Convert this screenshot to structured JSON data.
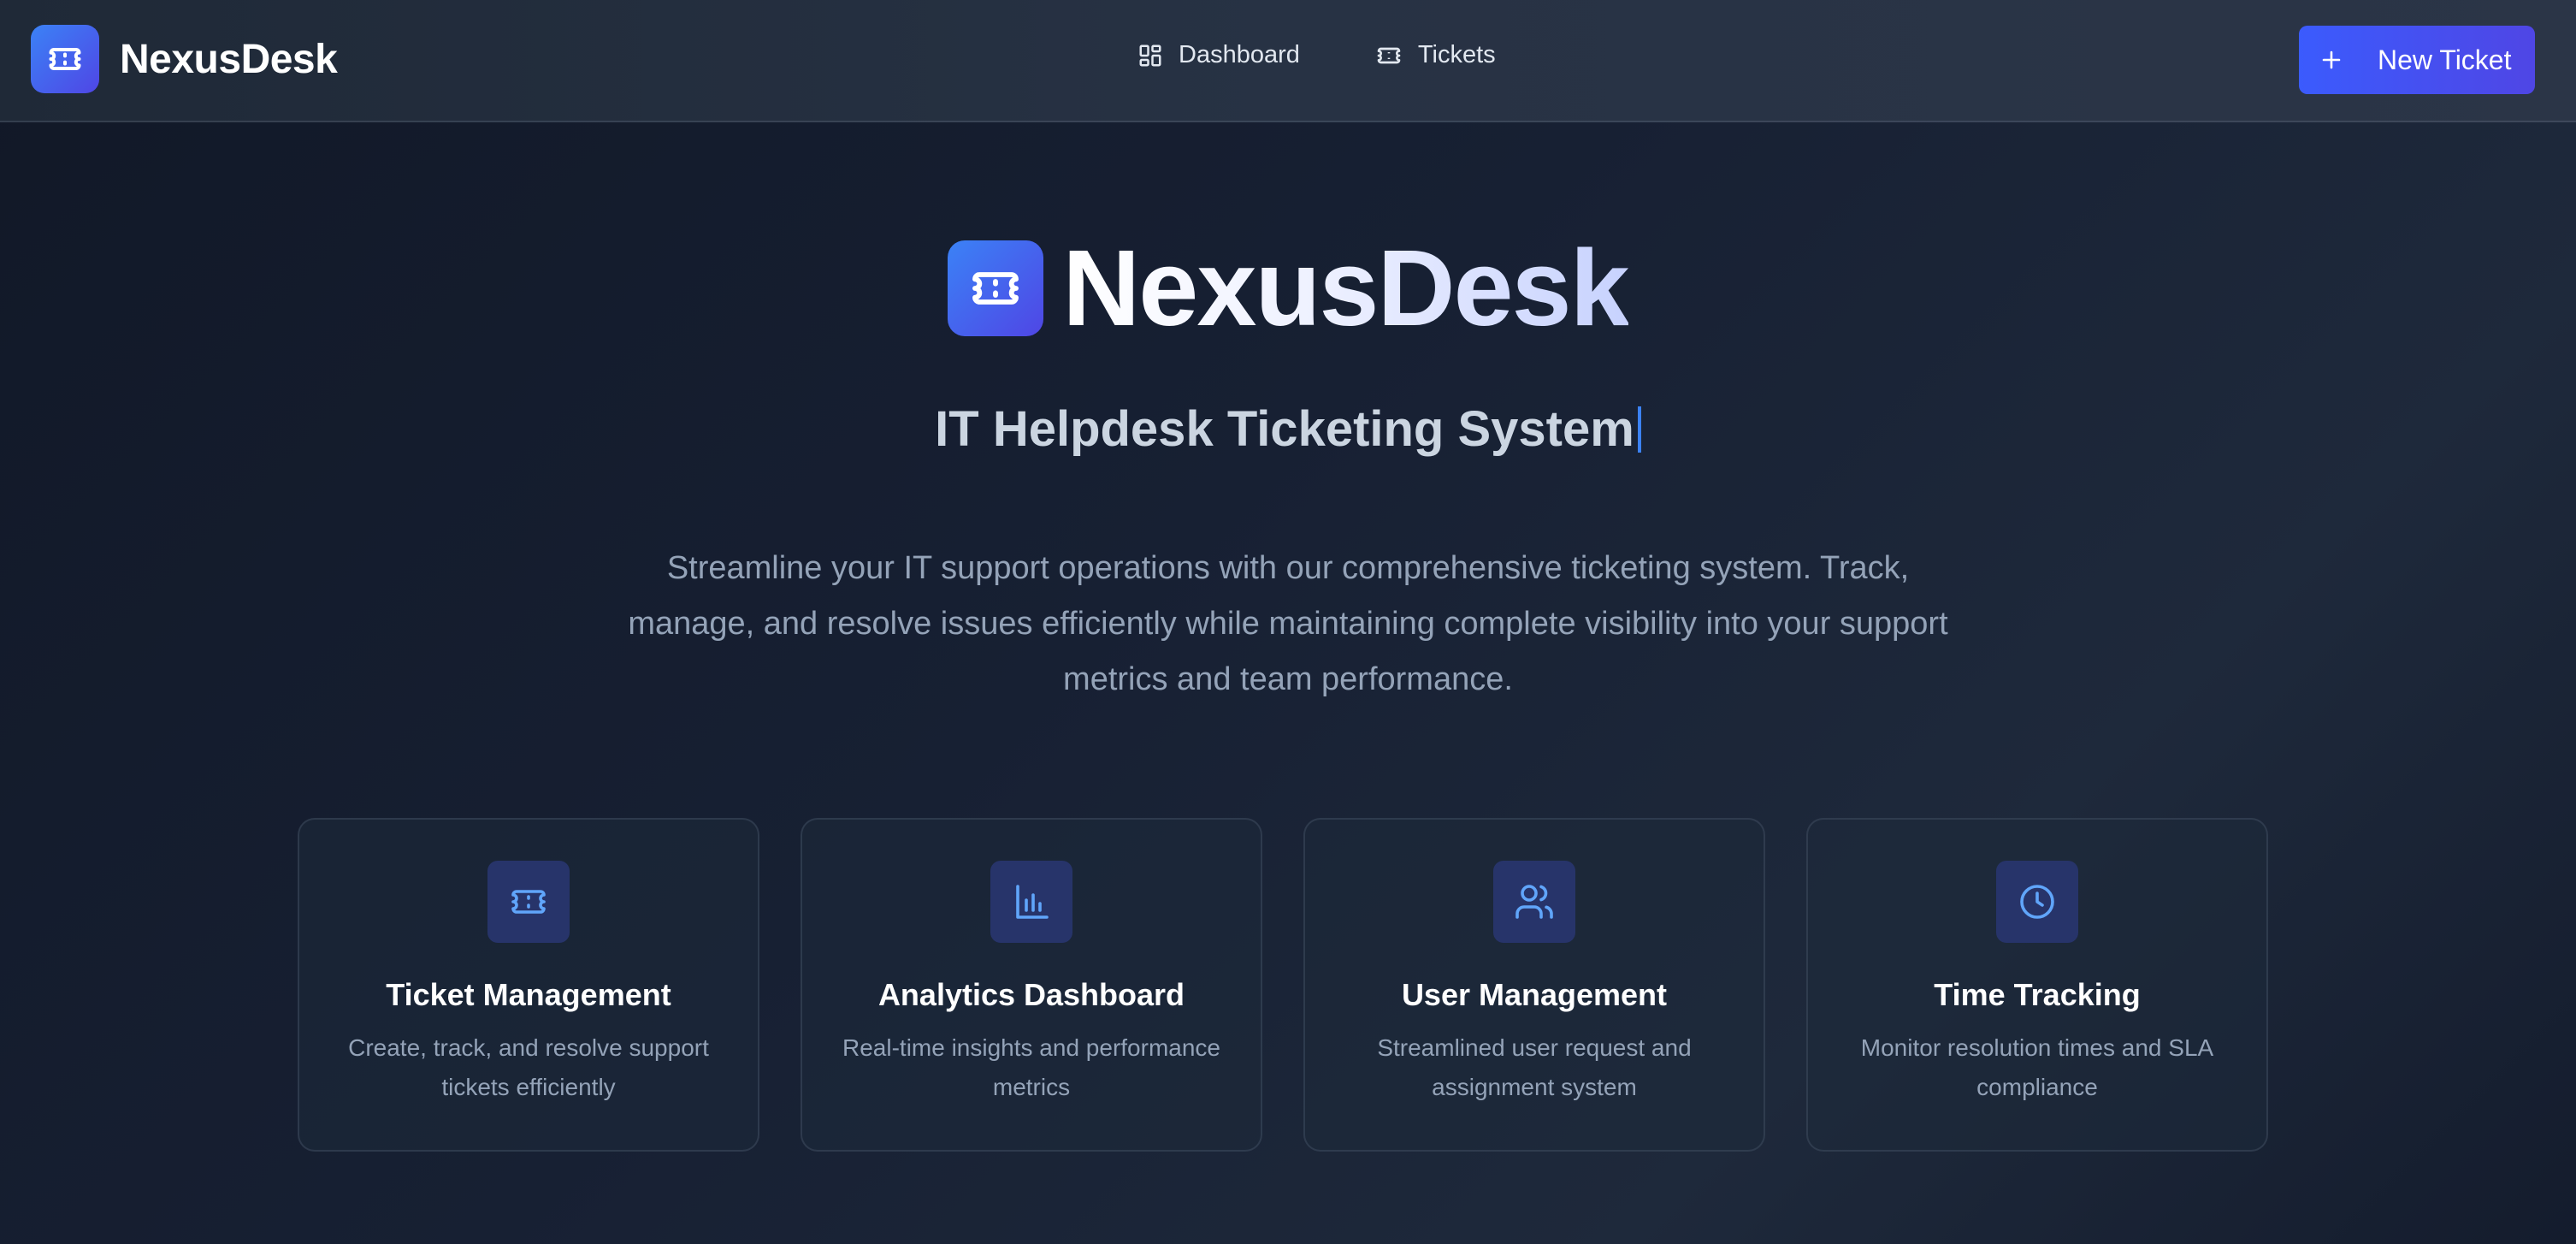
{
  "header": {
    "brand_name": "NexusDesk",
    "brand_icon": "ticket-icon",
    "nav": [
      {
        "label": "Dashboard",
        "icon": "dashboard-grid-icon"
      },
      {
        "label": "Tickets",
        "icon": "ticket-icon"
      }
    ],
    "new_ticket_label": "New Ticket",
    "new_ticket_icon": "plus-icon"
  },
  "hero": {
    "title": "NexusDesk",
    "subtitle": "IT Helpdesk Ticketing System",
    "description": "Streamline your IT support operations with our comprehensive ticketing system. Track, manage, and resolve issues efficiently while maintaining complete visibility into your support metrics and team performance."
  },
  "features": [
    {
      "title": "Ticket Management",
      "description": "Create, track, and resolve support tickets efficiently",
      "icon": "ticket-icon"
    },
    {
      "title": "Analytics Dashboard",
      "description": "Real-time insights and performance metrics",
      "icon": "bar-chart-icon"
    },
    {
      "title": "User Management",
      "description": "Streamlined user request and assignment system",
      "icon": "users-icon"
    },
    {
      "title": "Time Tracking",
      "description": "Monitor resolution times and SLA compliance",
      "icon": "clock-icon"
    }
  ],
  "colors": {
    "accent": "#3b82f6",
    "accent_secondary": "#4f46e5",
    "background": "#111827",
    "card_icon_bg": "#27346a"
  }
}
